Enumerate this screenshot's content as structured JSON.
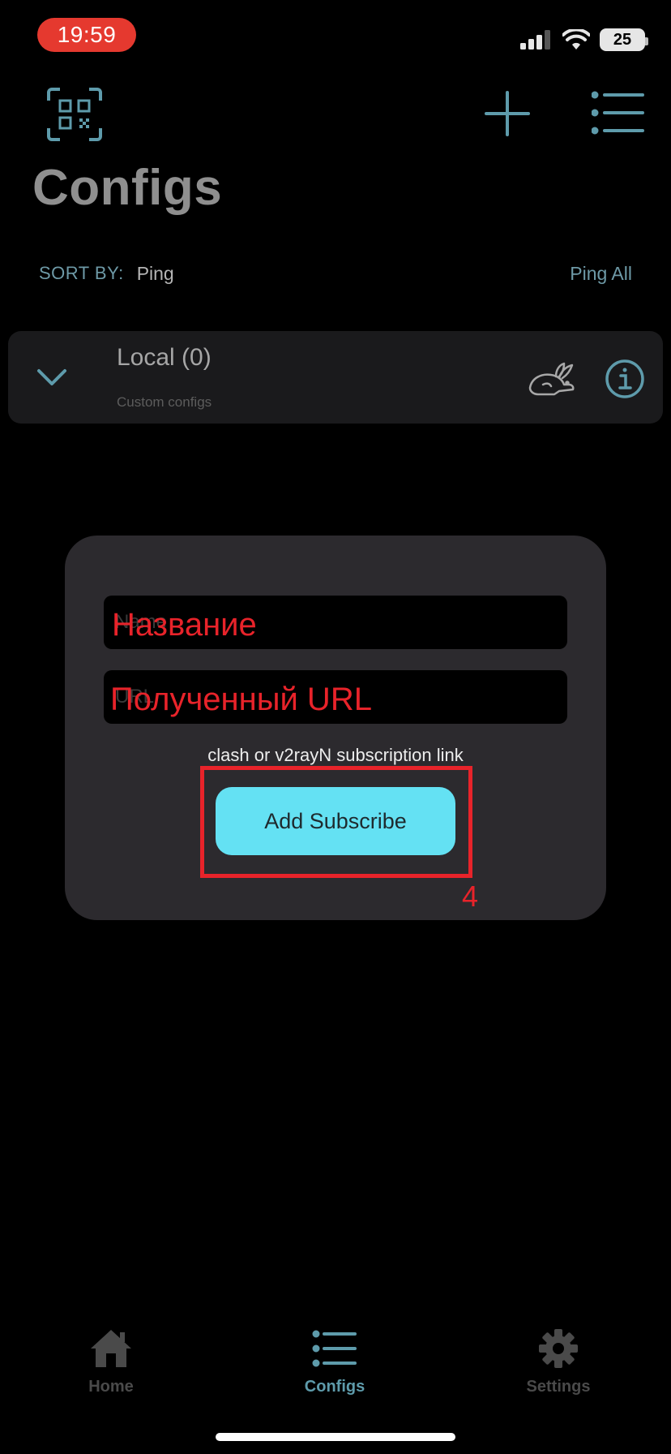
{
  "status_bar": {
    "time": "19:59",
    "battery": "25",
    "icons": [
      "cellular-signal-icon",
      "wifi-icon",
      "battery-icon"
    ]
  },
  "header": {
    "title": "Configs",
    "icons": [
      "qr-scan-icon",
      "plus-icon",
      "list-icon"
    ]
  },
  "sort": {
    "label": "SORT BY:",
    "value": "Ping",
    "ping_all_label": "Ping All"
  },
  "group": {
    "name": "Local (0)",
    "subtitle": "Custom configs",
    "icons": [
      "chevron-down-icon",
      "rabbit-icon",
      "info-icon"
    ]
  },
  "dialog": {
    "name_placeholder": "Name",
    "url_placeholder": "URL",
    "hint": "clash or v2rayN subscription link",
    "button_label": "Add Subscribe"
  },
  "annotations": {
    "name_label": "Название",
    "url_label": "Полученный URL",
    "step_number": "4"
  },
  "tabs": [
    {
      "label": "Home",
      "icon": "home-icon"
    },
    {
      "label": "Configs",
      "icon": "list-icon",
      "active": true
    },
    {
      "label": "Settings",
      "icon": "gear-icon"
    }
  ],
  "colors": {
    "accent": "#5e9bab",
    "button": "#64e1f3",
    "annotation": "#e8232a",
    "inactive_tab": "#4a4a4a",
    "dialog_bg": "#2c2a2e"
  }
}
